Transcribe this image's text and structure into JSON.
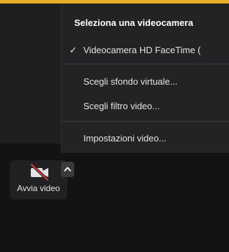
{
  "camera_menu": {
    "heading": "Seleziona una videocamera",
    "items": [
      {
        "label": "Videocamera HD FaceTime (",
        "checked": true,
        "check_glyph": "✓"
      },
      {
        "label": "Scegli sfondo virtuale...",
        "checked": false
      },
      {
        "label": "Scegli filtro video...",
        "checked": false
      },
      {
        "label": "Impostazioni video...",
        "checked": false
      }
    ]
  },
  "toolbar": {
    "video_button": {
      "label": "Avvia video",
      "icon": "video-camera-off-icon",
      "state": "off"
    },
    "options_chevron": {
      "icon": "chevron-up-icon"
    }
  },
  "colors": {
    "top_strip": "#e7ae27",
    "menu_background": "#232326",
    "toolbar_background": "#131314",
    "camera_off_slash": "#e0393e"
  }
}
